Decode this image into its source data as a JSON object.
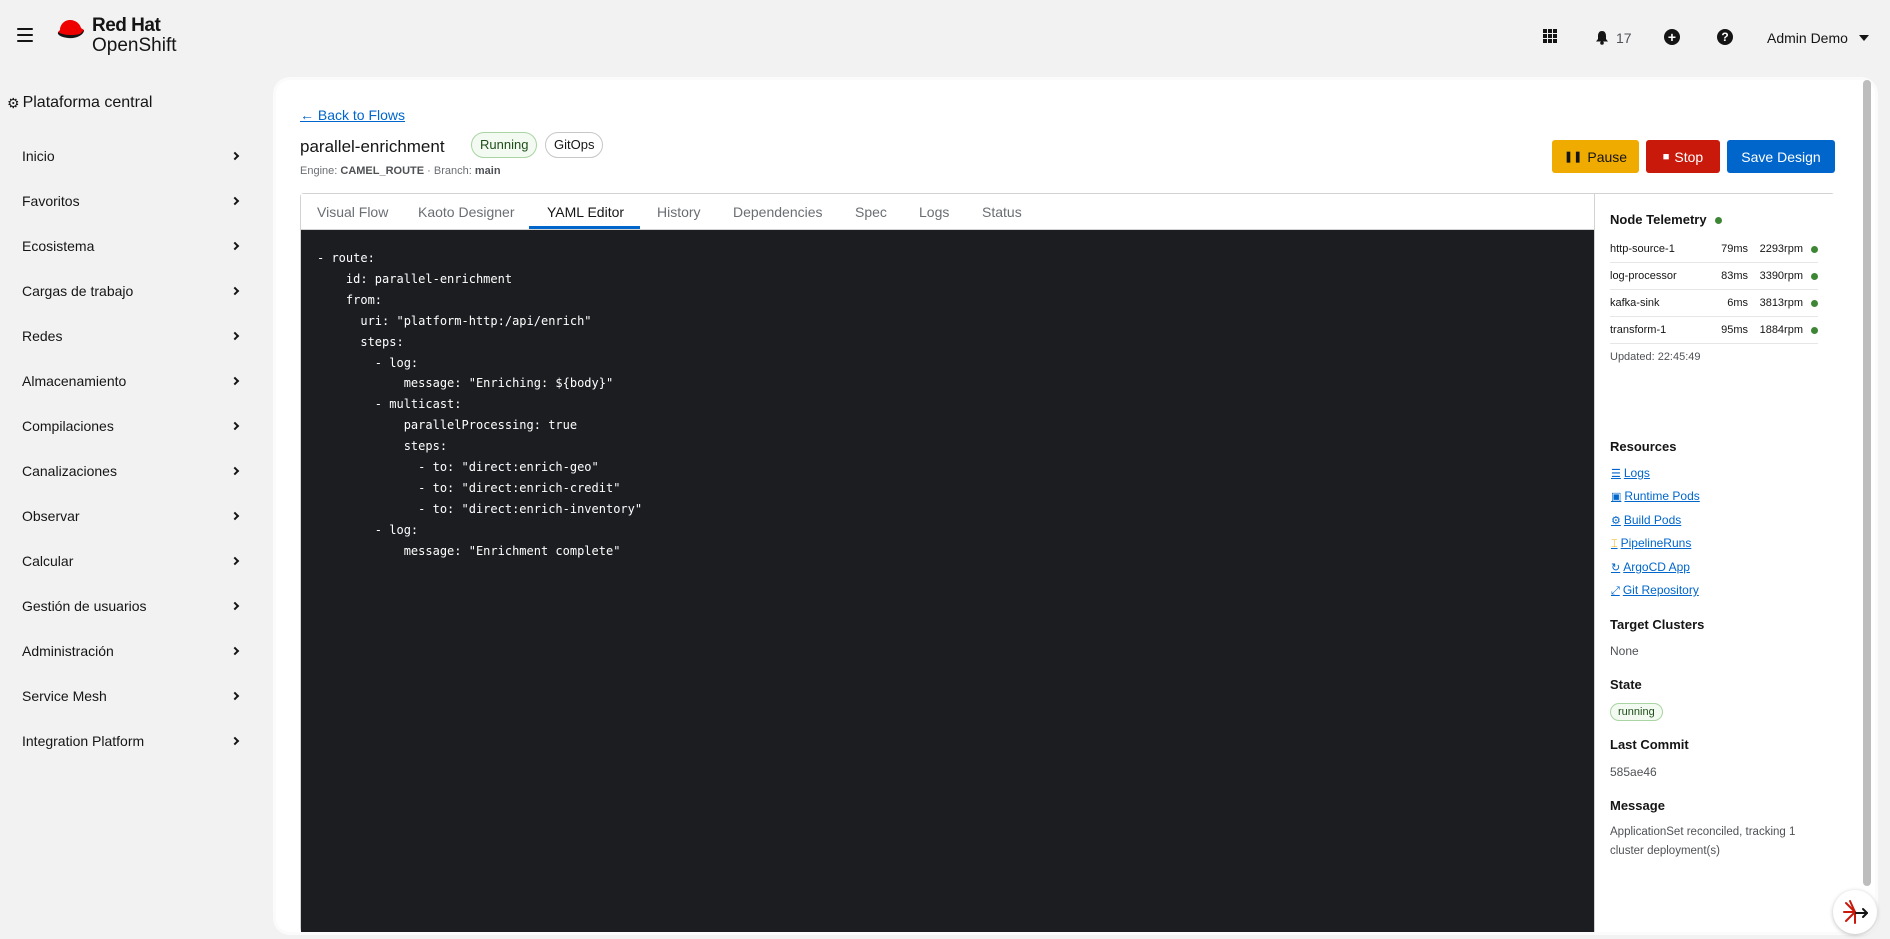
{
  "masthead": {
    "brand_line1": "Red Hat",
    "brand_line2": "OpenShift",
    "notification_count": "17",
    "user_name": "Admin Demo",
    "icons": [
      "menu-icon",
      "redhat-hat-logo",
      "app-launcher-icon",
      "bell-icon",
      "plus-circle-icon",
      "help-icon",
      "caret-down-icon"
    ]
  },
  "sidebar": {
    "perspective": "Plataforma central",
    "items": [
      {
        "label": "Inicio"
      },
      {
        "label": "Favoritos"
      },
      {
        "label": "Ecosistema"
      },
      {
        "label": "Cargas de trabajo"
      },
      {
        "label": "Redes"
      },
      {
        "label": "Almacenamiento"
      },
      {
        "label": "Compilaciones"
      },
      {
        "label": "Canalizaciones"
      },
      {
        "label": "Observar"
      },
      {
        "label": "Calcular"
      },
      {
        "label": "Gestión de usuarios"
      },
      {
        "label": "Administración"
      },
      {
        "label": "Service Mesh"
      },
      {
        "label": "Integration Platform"
      }
    ]
  },
  "header": {
    "back_link": "← Back to Flows",
    "title": "parallel-enrichment",
    "status_badge": "Running",
    "gitops_badge": "GitOps",
    "engine_label": "Engine:",
    "engine_value": "CAMEL_ROUTE",
    "branch_label": "· Branch:",
    "branch_value": "main"
  },
  "actions": {
    "pause": "Pause",
    "stop": "Stop",
    "save": "Save Design"
  },
  "tabs": [
    {
      "label": "Visual Flow"
    },
    {
      "label": "Kaoto Designer"
    },
    {
      "label": "YAML Editor",
      "active": true
    },
    {
      "label": "History"
    },
    {
      "label": "Dependencies"
    },
    {
      "label": "Spec"
    },
    {
      "label": "Logs"
    },
    {
      "label": "Status"
    }
  ],
  "yaml": "- route:\n    id: parallel-enrichment\n    from:\n      uri: \"platform-http:/api/enrich\"\n      steps:\n        - log:\n            message: \"Enriching: ${body}\"\n        - multicast:\n            parallelProcessing: true\n            steps:\n              - to: \"direct:enrich-geo\"\n              - to: \"direct:enrich-credit\"\n              - to: \"direct:enrich-inventory\"\n        - log:\n            message: \"Enrichment complete\"",
  "telemetry": {
    "title": "Node Telemetry",
    "rows": [
      {
        "name": "http-source-1",
        "latency": "79ms",
        "rpm": "2293rpm"
      },
      {
        "name": "log-processor",
        "latency": "83ms",
        "rpm": "3390rpm"
      },
      {
        "name": "kafka-sink",
        "latency": "6ms",
        "rpm": "3813rpm"
      },
      {
        "name": "transform-1",
        "latency": "95ms",
        "rpm": "1884rpm"
      }
    ],
    "updated": "Updated: 22:45:49",
    "status_color": "#3e8635"
  },
  "resources": {
    "title": "Resources",
    "links": [
      {
        "icon": "☰",
        "label": "Logs"
      },
      {
        "icon": "▣",
        "label": "Runtime Pods"
      },
      {
        "icon": "⚙",
        "label": "Build Pods"
      },
      {
        "icon": "⌶",
        "label": "PipelineRuns"
      },
      {
        "icon": "↻",
        "label": "ArgoCD App"
      },
      {
        "icon": "⤢",
        "label": "Git Repository"
      }
    ]
  },
  "details": {
    "target_clusters_label": "Target Clusters",
    "target_clusters_value": "None",
    "state_label": "State",
    "state_value": "running",
    "last_commit_label": "Last Commit",
    "last_commit_value": "585ae46",
    "message_label": "Message",
    "message_value": "ApplicationSet reconciled, tracking 1 cluster deployment(s)"
  },
  "colors": {
    "accent": "#0066cc",
    "pause": "#f0ab00",
    "stop": "#c9190b",
    "editor_bg": "#1b1d21"
  }
}
